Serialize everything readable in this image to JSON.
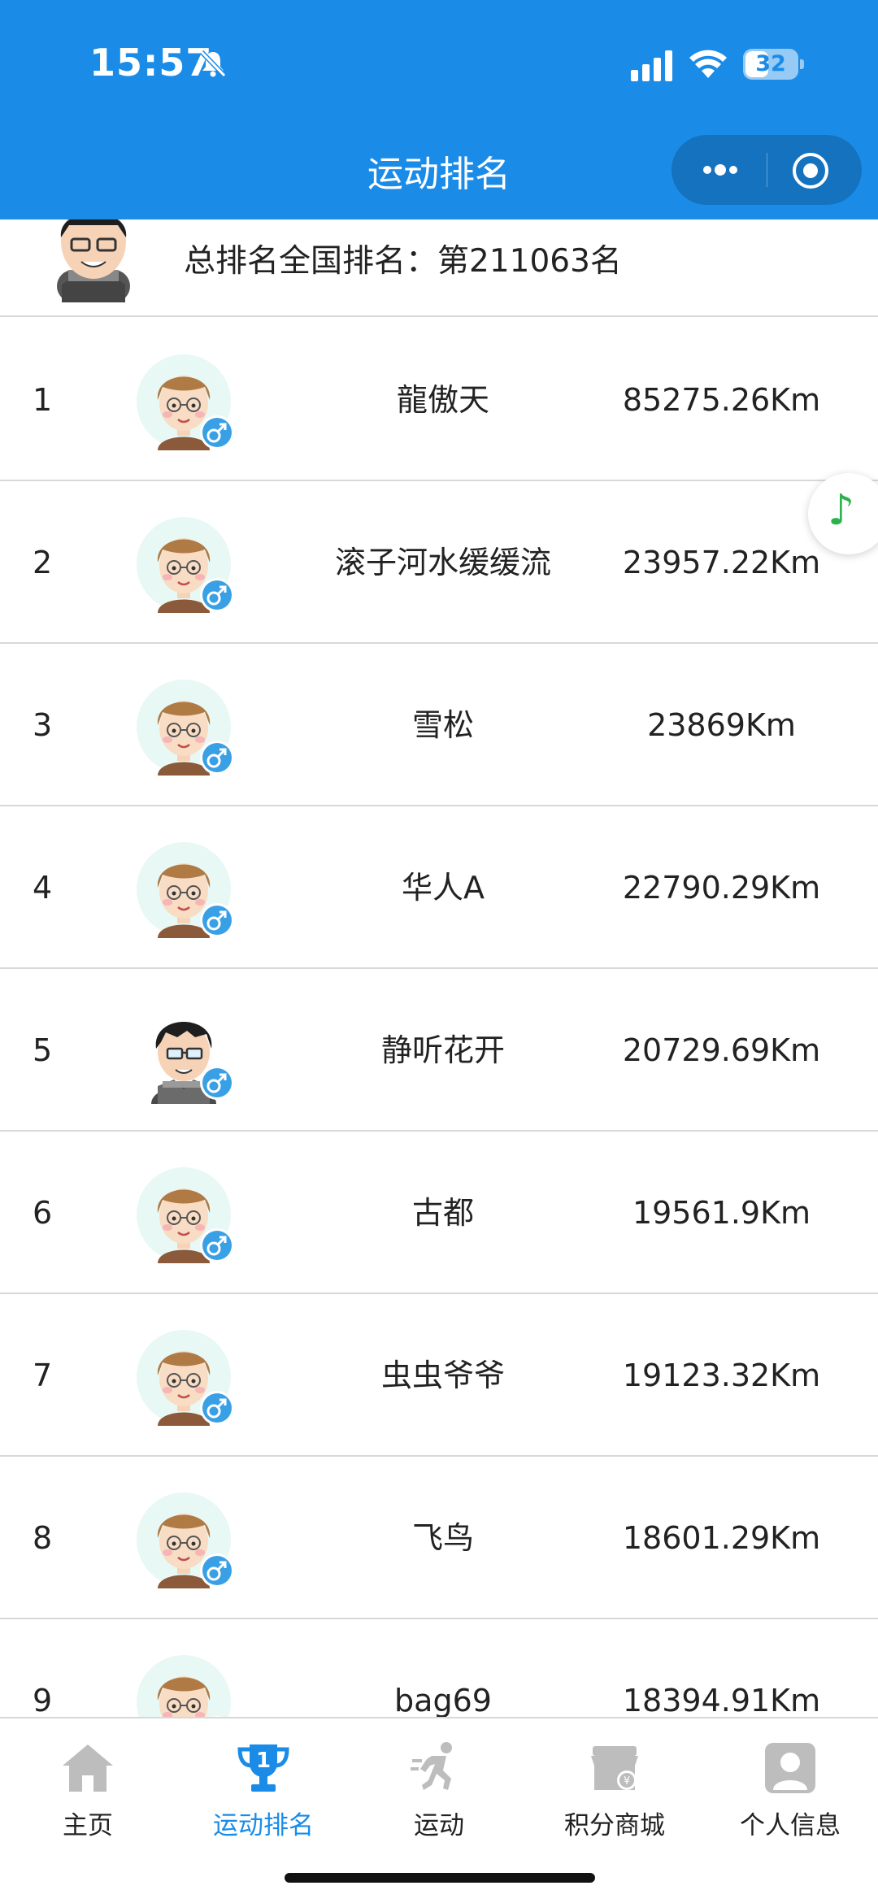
{
  "status_bar": {
    "time": "15:57",
    "battery": "32"
  },
  "nav": {
    "title": "运动排名"
  },
  "summary": {
    "text": "总排名全国排名：第211063名"
  },
  "ranking": [
    {
      "rank": "1",
      "name": "龍傲天",
      "distance": "85275.26Km",
      "avatar": "default"
    },
    {
      "rank": "2",
      "name": "滚子河水缓缓流",
      "distance": "23957.22Km",
      "avatar": "default"
    },
    {
      "rank": "3",
      "name": "雪松",
      "distance": "23869Km",
      "avatar": "default"
    },
    {
      "rank": "4",
      "name": "华人A",
      "distance": "22790.29Km",
      "avatar": "default"
    },
    {
      "rank": "5",
      "name": "静听花开",
      "distance": "20729.69Km",
      "avatar": "glasses"
    },
    {
      "rank": "6",
      "name": "古都",
      "distance": "19561.9Km",
      "avatar": "default"
    },
    {
      "rank": "7",
      "name": "虫虫爷爷",
      "distance": "19123.32Km",
      "avatar": "default"
    },
    {
      "rank": "8",
      "name": "飞鸟",
      "distance": "18601.29Km",
      "avatar": "default"
    },
    {
      "rank": "9",
      "name": "bag69",
      "distance": "18394.91Km",
      "avatar": "default"
    }
  ],
  "tabs": [
    {
      "label": "主页",
      "icon": "home-icon",
      "active": false
    },
    {
      "label": "运动排名",
      "icon": "trophy-icon",
      "active": true
    },
    {
      "label": "运动",
      "icon": "running-icon",
      "active": false
    },
    {
      "label": "积分商城",
      "icon": "store-icon",
      "active": false
    },
    {
      "label": "个人信息",
      "icon": "profile-icon",
      "active": false
    }
  ],
  "colors": {
    "primary": "#1a8ce8",
    "text": "#222222",
    "divider": "#d8d8d8",
    "music": "#2bb24c",
    "male_badge": "#3aa0e6"
  }
}
